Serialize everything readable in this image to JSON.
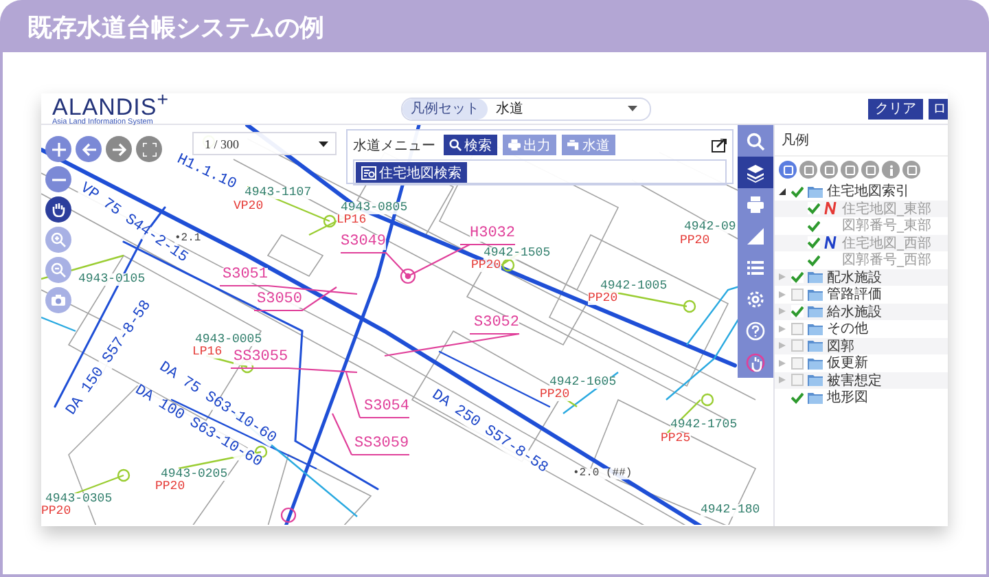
{
  "title": "既存水道台帳システムの例",
  "app": {
    "logo": "ALANDIS$^{+}$",
    "logo_subtitle": "Asia Land Information System",
    "legend_set": {
      "label": "凡例セット",
      "value": "水道"
    },
    "buttons": [
      "クリア",
      "ロ"
    ]
  },
  "scale": {
    "value": "1 / 300"
  },
  "water_menu": {
    "label": "水道メニュー",
    "buttons": [
      {
        "label": "検索",
        "selected": true
      },
      {
        "label": "出力",
        "selected": false
      },
      {
        "label": "水道",
        "selected": false
      }
    ],
    "map_search_button": "住宅地図検索"
  },
  "map": {
    "labels": [
      {
        "kind": "pipe",
        "text": "VP 75 S44-2-15"
      },
      {
        "kind": "pipe",
        "text": "H1.1.10"
      },
      {
        "kind": "pipe",
        "text": "DA 150 S57-8-58"
      },
      {
        "kind": "pipe",
        "text": "DA 75 S63-10-60"
      },
      {
        "kind": "pipe",
        "text": "DA 100 S63-10-60"
      },
      {
        "kind": "pipe",
        "text": "DA 250 S57-8-58"
      },
      {
        "kind": "parcel",
        "text": "4943-1107"
      },
      {
        "kind": "meter",
        "text": "VP20"
      },
      {
        "kind": "parcel",
        "text": "4943-0805"
      },
      {
        "kind": "meter",
        "text": "LP16"
      },
      {
        "kind": "parcel",
        "text": "4943-0105"
      },
      {
        "kind": "parcel",
        "text": "4943-0005"
      },
      {
        "kind": "meter",
        "text": "LP16"
      },
      {
        "kind": "parcel",
        "text": "4943-0205"
      },
      {
        "kind": "meter",
        "text": "PP20"
      },
      {
        "kind": "parcel",
        "text": "4943-0305"
      },
      {
        "kind": "meter",
        "text": "PP20"
      },
      {
        "kind": "parcel",
        "text": "4942-09"
      },
      {
        "kind": "meter",
        "text": "PP20"
      },
      {
        "kind": "parcel",
        "text": "4942-1505"
      },
      {
        "kind": "meter",
        "text": "PP20"
      },
      {
        "kind": "parcel",
        "text": "4942-1005"
      },
      {
        "kind": "meter",
        "text": "PP20"
      },
      {
        "kind": "parcel",
        "text": "4942-1605"
      },
      {
        "kind": "meter",
        "text": "PP20"
      },
      {
        "kind": "parcel",
        "text": "4942-1705"
      },
      {
        "kind": "meter",
        "text": "PP25"
      },
      {
        "kind": "parcel",
        "text": "4942-180"
      },
      {
        "kind": "facility",
        "text": "H3032"
      },
      {
        "kind": "facility",
        "text": "S3049"
      },
      {
        "kind": "facility",
        "text": "S3051"
      },
      {
        "kind": "facility",
        "text": "S3050"
      },
      {
        "kind": "facility",
        "text": "S3052"
      },
      {
        "kind": "facility",
        "text": "SS3055"
      },
      {
        "kind": "facility",
        "text": "S3054"
      },
      {
        "kind": "facility",
        "text": "SS3059"
      },
      {
        "kind": "elevation",
        "text": "•2.1"
      },
      {
        "kind": "elevation",
        "text": "•2.0 (##)"
      }
    ]
  },
  "tool_rail": [
    {
      "selected": false
    },
    {
      "selected": true
    },
    {
      "selected": false
    },
    {
      "selected": false
    },
    {
      "selected": false
    },
    {
      "selected": false
    },
    {
      "selected": false
    },
    {
      "selected": false
    }
  ],
  "legend": {
    "title": "凡例",
    "tools": [
      {
        "selected": true
      },
      {
        "selected": false
      },
      {
        "selected": false
      },
      {
        "selected": false
      },
      {
        "selected": false
      },
      {
        "selected": false
      },
      {
        "selected": false
      }
    ],
    "items": [
      {
        "kind": "group",
        "label": "住宅地図索引",
        "checked": true,
        "expanded": true,
        "children": [
          {
            "label": "住宅地図_東部",
            "checked": true,
            "color": "#e53935"
          },
          {
            "label": "図郭番号_東部",
            "checked": true
          },
          {
            "label": "住宅地図_西部",
            "checked": true,
            "color": "#1e3fc8"
          },
          {
            "label": "図郭番号_西部",
            "checked": true
          }
        ]
      },
      {
        "kind": "group",
        "label": "配水施設",
        "checked": true,
        "expanded": false
      },
      {
        "kind": "group",
        "label": "管路評価",
        "checked": false,
        "expanded": false
      },
      {
        "kind": "group",
        "label": "給水施設",
        "checked": true,
        "expanded": false
      },
      {
        "kind": "group",
        "label": "その他",
        "checked": false,
        "expanded": false
      },
      {
        "kind": "group",
        "label": "図郭",
        "checked": false,
        "expanded": false
      },
      {
        "kind": "group",
        "label": "仮更新",
        "checked": false,
        "expanded": false
      },
      {
        "kind": "group",
        "label": "被害想定",
        "checked": false,
        "expanded": false
      },
      {
        "kind": "layer",
        "label": "地形図",
        "checked": true
      }
    ]
  }
}
